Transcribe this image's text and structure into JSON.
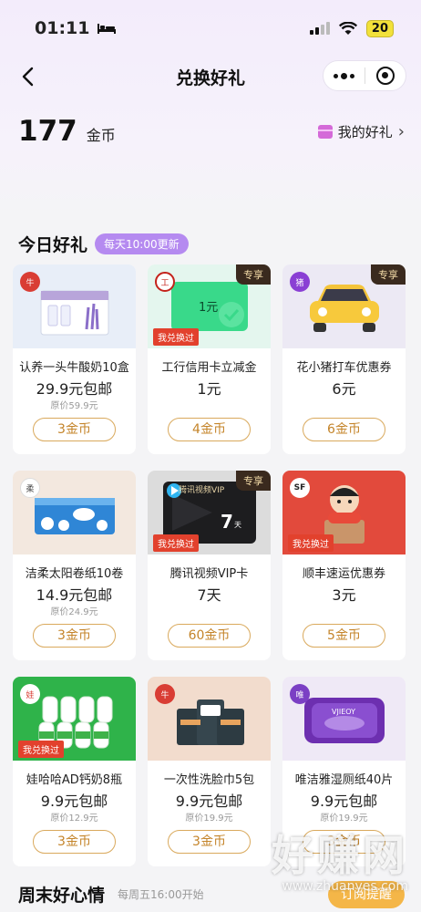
{
  "status": {
    "time": "01:11",
    "battery": "20"
  },
  "nav": {
    "title": "兑换好礼"
  },
  "coins": {
    "amount": "177",
    "unit": "金币"
  },
  "my_gifts": {
    "label": "我的好礼",
    "chevron": "›"
  },
  "today": {
    "title": "今日好礼",
    "badge": "每天10:00更新"
  },
  "cards": [
    {
      "name": "认养一头牛酸奶10盒",
      "price": "29.9元包邮",
      "orig": "原价59.9元",
      "cost": "3金币",
      "tag_exclusive": "",
      "tag_redeemed": "",
      "icon": "yogurt-box-icon"
    },
    {
      "name": "工行信用卡立减金",
      "price": "1元",
      "orig": "",
      "cost": "4金币",
      "tag_exclusive": "专享",
      "tag_redeemed": "我兑换过",
      "icon": "bank-card-icon",
      "voucher": "1元"
    },
    {
      "name": "花小猪打车优惠券",
      "price": "6元",
      "orig": "",
      "cost": "6金币",
      "tag_exclusive": "专享",
      "tag_redeemed": "",
      "icon": "car-icon"
    },
    {
      "name": "洁柔太阳卷纸10卷",
      "price": "14.9元包邮",
      "orig": "原价24.9元",
      "cost": "3金币",
      "tag_exclusive": "",
      "tag_redeemed": "",
      "icon": "tissue-roll-icon"
    },
    {
      "name": "腾讯视频VIP卡",
      "price": "7天",
      "orig": "",
      "cost": "60金币",
      "tag_exclusive": "专享",
      "tag_redeemed": "我兑换过",
      "icon": "video-vip-card-icon",
      "card_brand": "腾讯视频VIP",
      "card_days": "7",
      "card_unit": "天"
    },
    {
      "name": "顺丰速运优惠券",
      "price": "3元",
      "orig": "",
      "cost": "5金币",
      "tag_exclusive": "",
      "tag_redeemed": "我兑换过",
      "icon": "courier-icon"
    },
    {
      "name": "娃哈哈AD钙奶8瓶",
      "price": "9.9元包邮",
      "orig": "原价12.9元",
      "cost": "3金币",
      "tag_exclusive": "",
      "tag_redeemed": "我兑换过",
      "icon": "milk-bottles-icon"
    },
    {
      "name": "一次性洗脸巾5包",
      "price": "9.9元包邮",
      "orig": "原价19.9元",
      "cost": "3金币",
      "tag_exclusive": "",
      "tag_redeemed": "",
      "icon": "face-towel-icon"
    },
    {
      "name": "唯洁雅湿厕纸40片",
      "price": "9.9元包邮",
      "orig": "原价19.9元",
      "cost": "3金币",
      "tag_exclusive": "",
      "tag_redeemed": "",
      "icon": "wet-wipes-icon",
      "pack_label": "VJIEOY"
    }
  ],
  "weekend": {
    "title": "周末好心情",
    "subtitle": "每周五16:00开始",
    "button": "订阅提醒"
  },
  "watermark": {
    "main": "好赚网",
    "sub": "www.zhuanyes.com"
  },
  "colors": {
    "accent_gold": "#c4842a",
    "badge_purple": "#b58af0",
    "tag_red": "#e2412d"
  }
}
